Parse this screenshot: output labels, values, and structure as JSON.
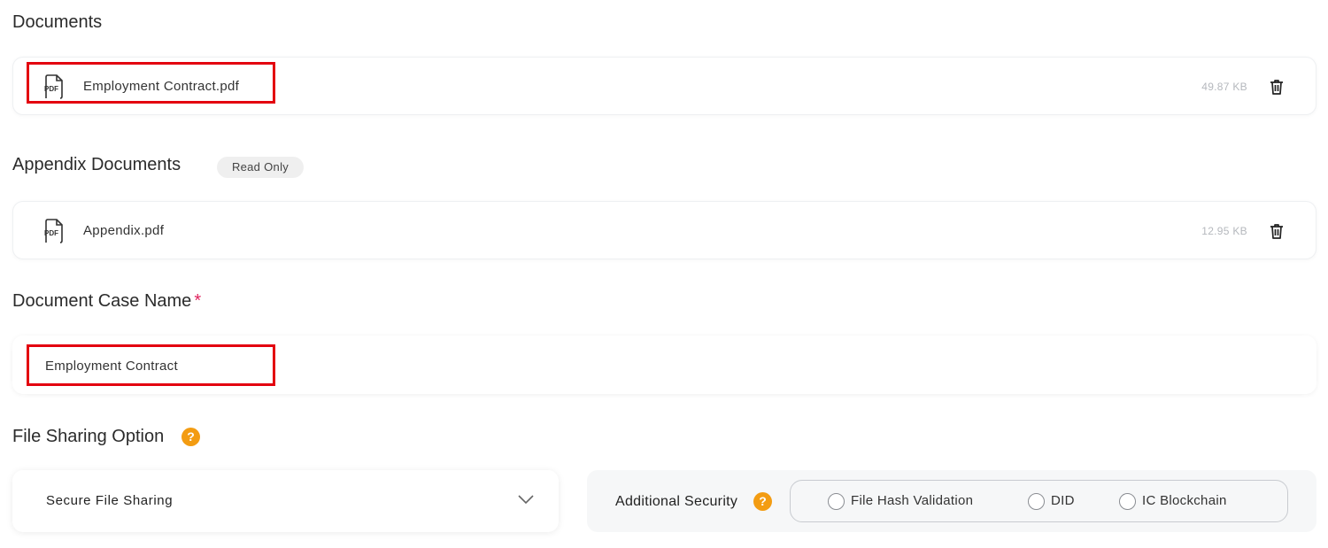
{
  "documents": {
    "title": "Documents",
    "files": [
      {
        "name": "Employment Contract.pdf",
        "size": "49.87 KB",
        "type_icon": "pdf-icon"
      }
    ]
  },
  "appendix": {
    "title": "Appendix Documents",
    "badge": "Read Only",
    "files": [
      {
        "name": "Appendix.pdf",
        "size": "12.95 KB",
        "type_icon": "pdf-icon"
      }
    ]
  },
  "case_name": {
    "label": "Document Case Name",
    "required_mark": "*",
    "value": "Employment Contract"
  },
  "sharing": {
    "title": "File Sharing Option",
    "help_glyph": "?",
    "selected": "Secure File Sharing",
    "additional_security": {
      "label": "Additional Security",
      "help_glyph": "?",
      "options": [
        "File Hash Validation",
        "DID",
        "IC Blockchain"
      ]
    }
  },
  "colors": {
    "help_badge": "#f39c12",
    "required": "#e0245e",
    "highlight_box": "#e3000f"
  }
}
